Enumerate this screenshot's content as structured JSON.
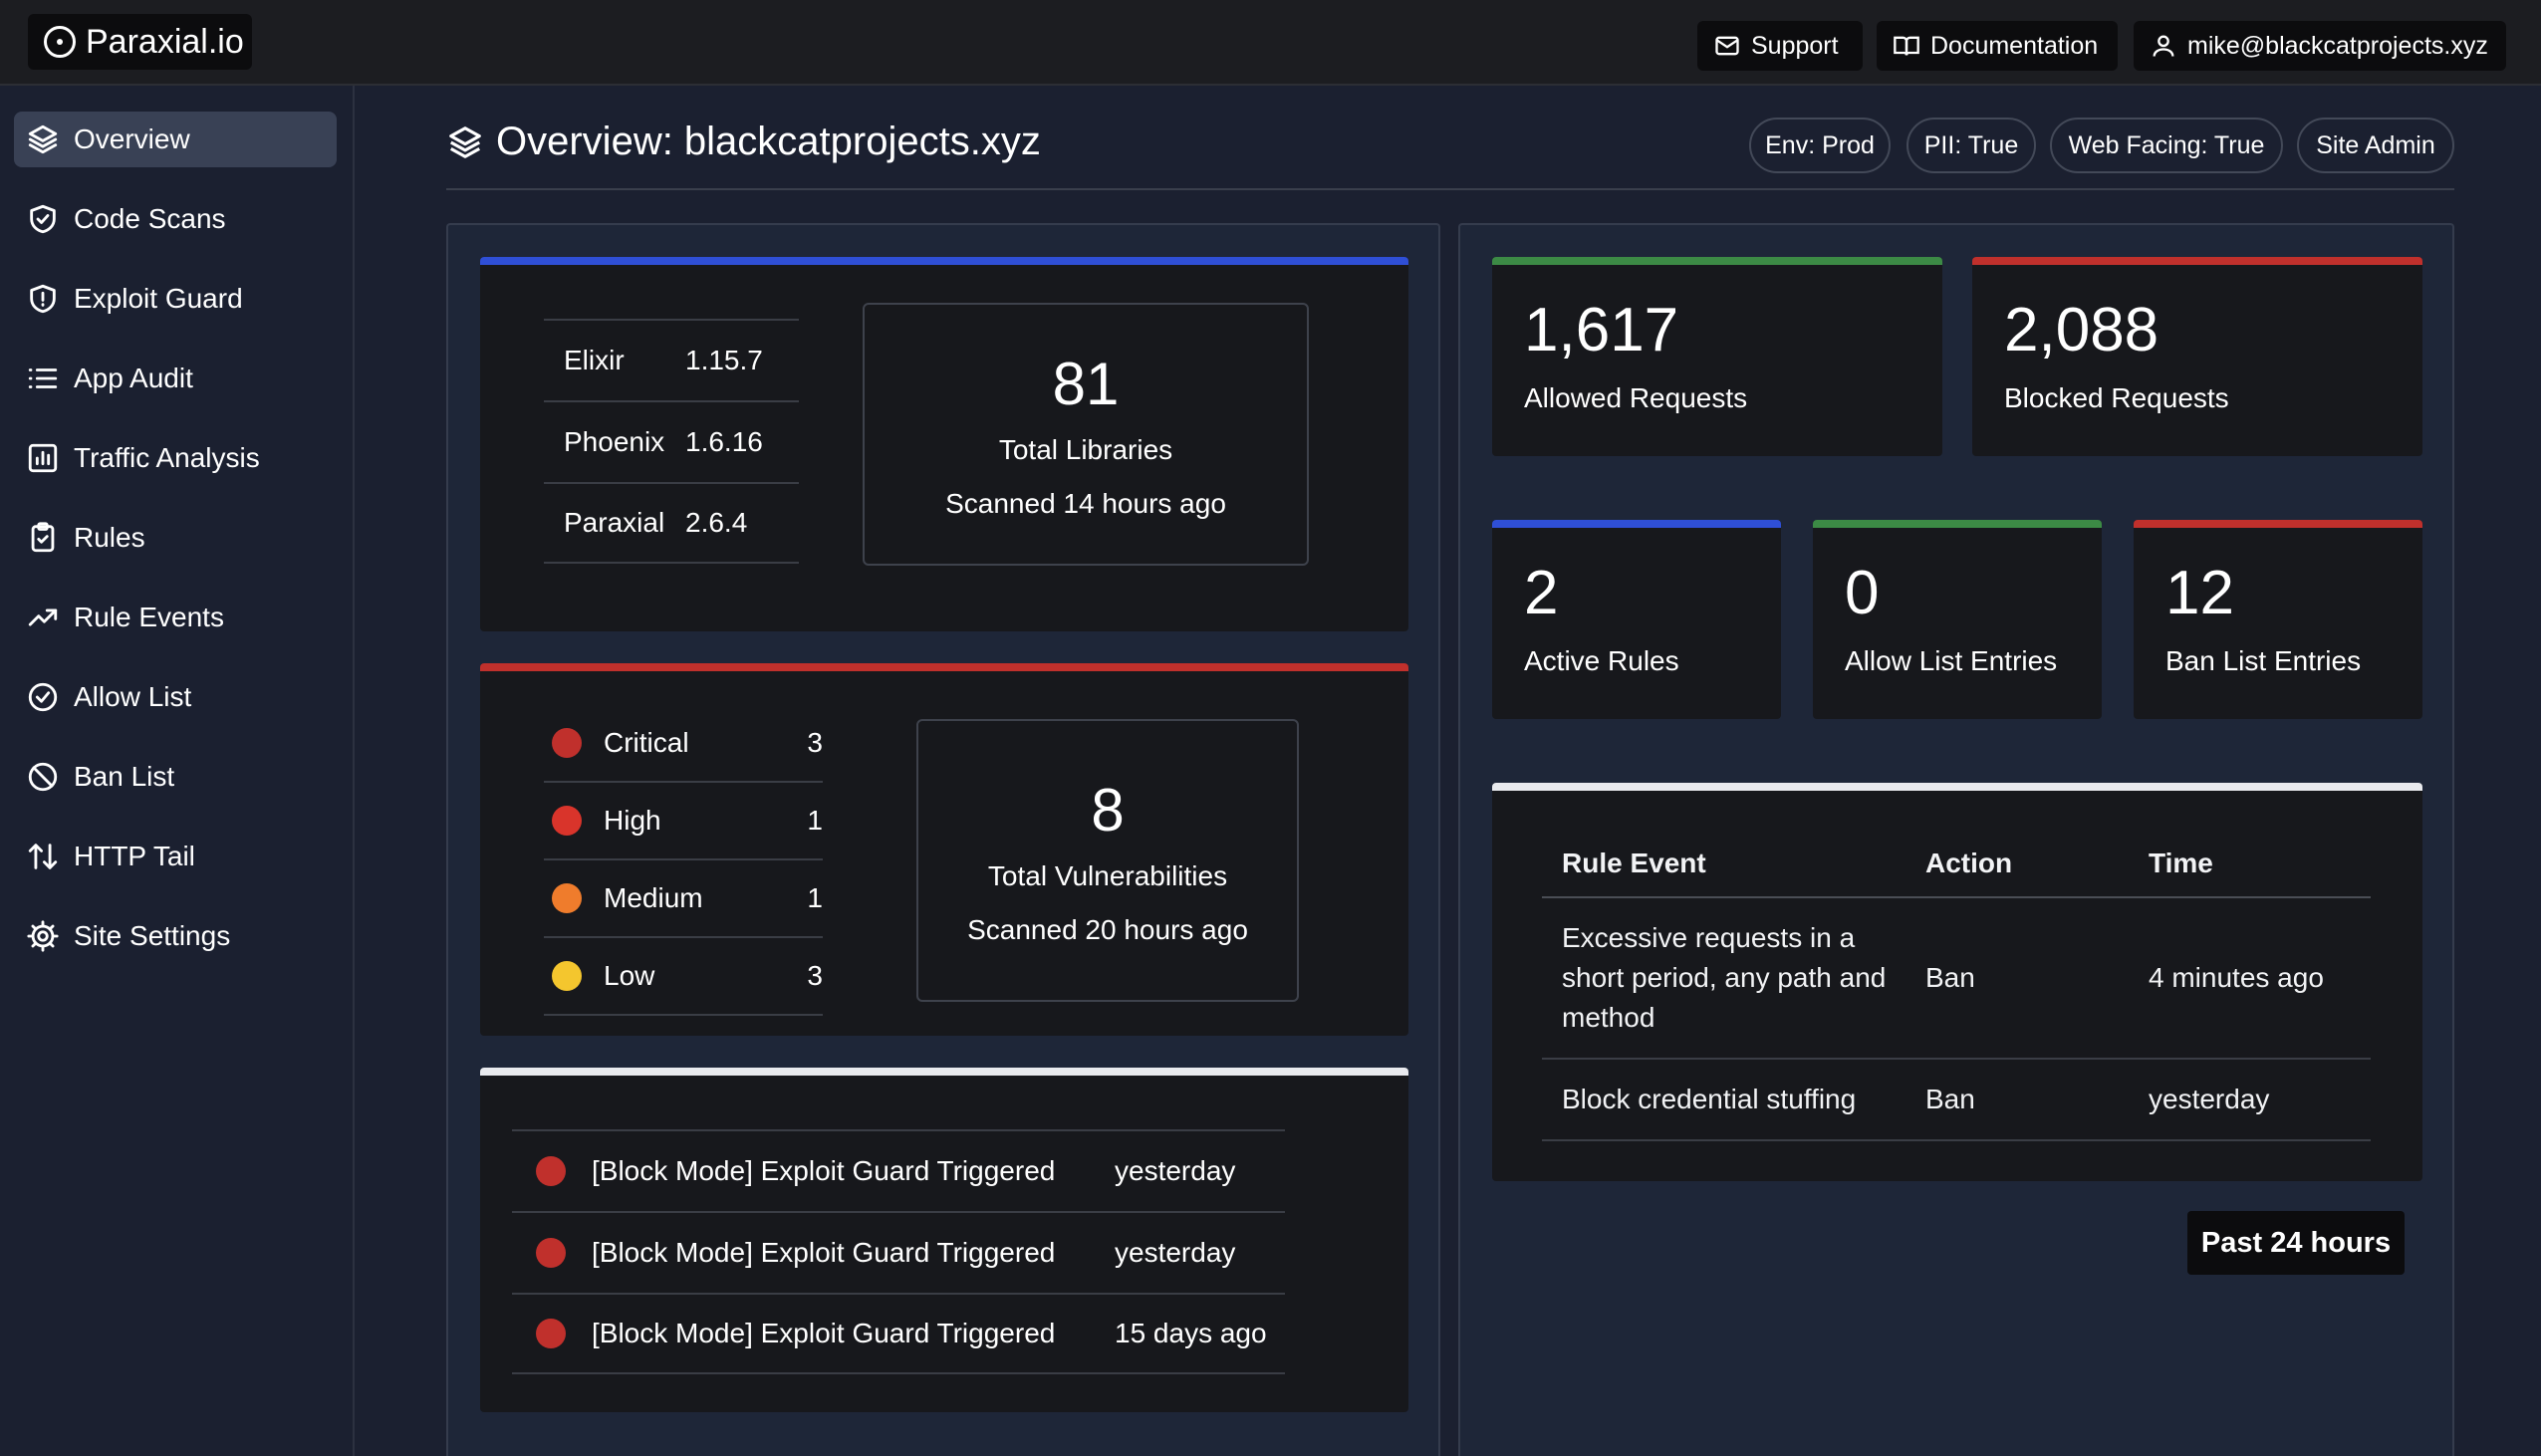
{
  "brand": {
    "name": "Paraxial.io"
  },
  "topbar": {
    "support_label": "Support",
    "docs_label": "Documentation",
    "user_email": "mike@blackcatprojects.xyz"
  },
  "sidebar": {
    "items": [
      {
        "label": "Overview",
        "icon": "layers-icon"
      },
      {
        "label": "Code Scans",
        "icon": "shield-check-icon"
      },
      {
        "label": "Exploit Guard",
        "icon": "shield-alert-icon"
      },
      {
        "label": "App Audit",
        "icon": "list-icon"
      },
      {
        "label": "Traffic Analysis",
        "icon": "bar-chart-icon"
      },
      {
        "label": "Rules",
        "icon": "clipboard-icon"
      },
      {
        "label": "Rule Events",
        "icon": "trend-icon"
      },
      {
        "label": "Allow List",
        "icon": "check-circle-icon"
      },
      {
        "label": "Ban List",
        "icon": "ban-icon"
      },
      {
        "label": "HTTP Tail",
        "icon": "arrows-updown-icon"
      },
      {
        "label": "Site Settings",
        "icon": "gear-icon"
      }
    ],
    "active_index": 0
  },
  "header": {
    "title": "Overview: blackcatprojects.xyz",
    "chips": [
      "Env: Prod",
      "PII: True",
      "Web Facing: True",
      "Site Admin"
    ]
  },
  "versions": {
    "rows": [
      {
        "name": "Elixir",
        "version": "1.15.7"
      },
      {
        "name": "Phoenix",
        "version": "1.6.16"
      },
      {
        "name": "Paraxial",
        "version": "2.6.4"
      }
    ],
    "total": "81",
    "total_label": "Total Libraries",
    "scanned": "Scanned 14 hours ago"
  },
  "vulnerabilities": {
    "rows": [
      {
        "severity": "Critical",
        "count": "3",
        "color": "#c0302c"
      },
      {
        "severity": "High",
        "count": "1",
        "color": "#d9342b"
      },
      {
        "severity": "Medium",
        "count": "1",
        "color": "#ef7c2c"
      },
      {
        "severity": "Low",
        "count": "3",
        "color": "#f4c62e"
      }
    ],
    "total": "8",
    "total_label": "Total Vulnerabilities",
    "scanned": "Scanned 20 hours ago"
  },
  "exploit_events": [
    {
      "message": "[Block Mode] Exploit Guard Triggered",
      "time": "yesterday"
    },
    {
      "message": "[Block Mode] Exploit Guard Triggered",
      "time": "yesterday"
    },
    {
      "message": "[Block Mode] Exploit Guard Triggered",
      "time": "15 days ago"
    }
  ],
  "traffic": {
    "allowed": {
      "value": "1,617",
      "label": "Allowed Requests"
    },
    "blocked": {
      "value": "2,088",
      "label": "Blocked Requests"
    }
  },
  "counts": {
    "active_rules": {
      "value": "2",
      "label": "Active Rules"
    },
    "allow_list": {
      "value": "0",
      "label": "Allow List Entries"
    },
    "ban_list": {
      "value": "12",
      "label": "Ban List Entries"
    }
  },
  "rule_events": {
    "headers": [
      "Rule Event",
      "Action",
      "Time"
    ],
    "rows": [
      {
        "event": "Excessive requests in a short period, any path and method",
        "action": "Ban",
        "time": "4 minutes ago"
      },
      {
        "event": "Block credential stuffing",
        "action": "Ban",
        "time": "yesterday"
      }
    ]
  },
  "range_label": "Past 24 hours",
  "colors": {
    "blue": "#2f4fd6",
    "red": "#c0302c",
    "green": "#3c8a45",
    "white": "#e9eaee"
  }
}
